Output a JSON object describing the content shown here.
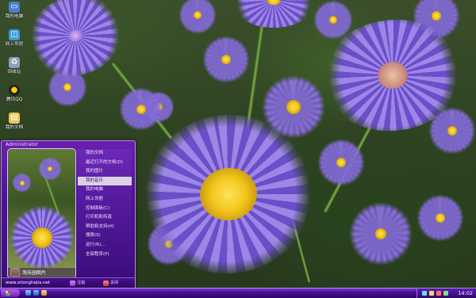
{
  "desktop": {
    "icons": [
      {
        "label": "我的电脑",
        "icon": "computer-icon",
        "color": "#4a7fd0"
      },
      {
        "label": "网上邻居",
        "icon": "network-icon",
        "color": "#3a9ad9"
      },
      {
        "label": "回收站",
        "icon": "recycle-bin-icon",
        "color": "#8aa1b9"
      },
      {
        "label": "腾讯QQ",
        "icon": "qq-penguin-icon",
        "color": "#222222"
      },
      {
        "label": "我的文档",
        "icon": "documents-icon",
        "color": "#e7c65a"
      },
      {
        "label": "",
        "icon": "internet-explorer-icon",
        "color": "#2a7de1"
      }
    ]
  },
  "start_menu": {
    "header": "Administrator",
    "photo_caption": "淘乐园图片",
    "items": [
      "我的文档",
      "最近打开的文档(D)",
      "我的图片",
      "我的音乐",
      "我的电脑",
      "网上邻居",
      "控制面板(C)",
      "打印机和传真",
      "帮助和支持(H)",
      "搜索(S)",
      "运行(R)...",
      "全部程序(P)"
    ],
    "highlighted_index": 3,
    "footer": {
      "site": "www.xitonghejia.net",
      "logoff_label": "注销",
      "shutdown_label": "关闭"
    }
  },
  "taskbar": {
    "clock": "14:02",
    "accent": "#4c1398"
  }
}
